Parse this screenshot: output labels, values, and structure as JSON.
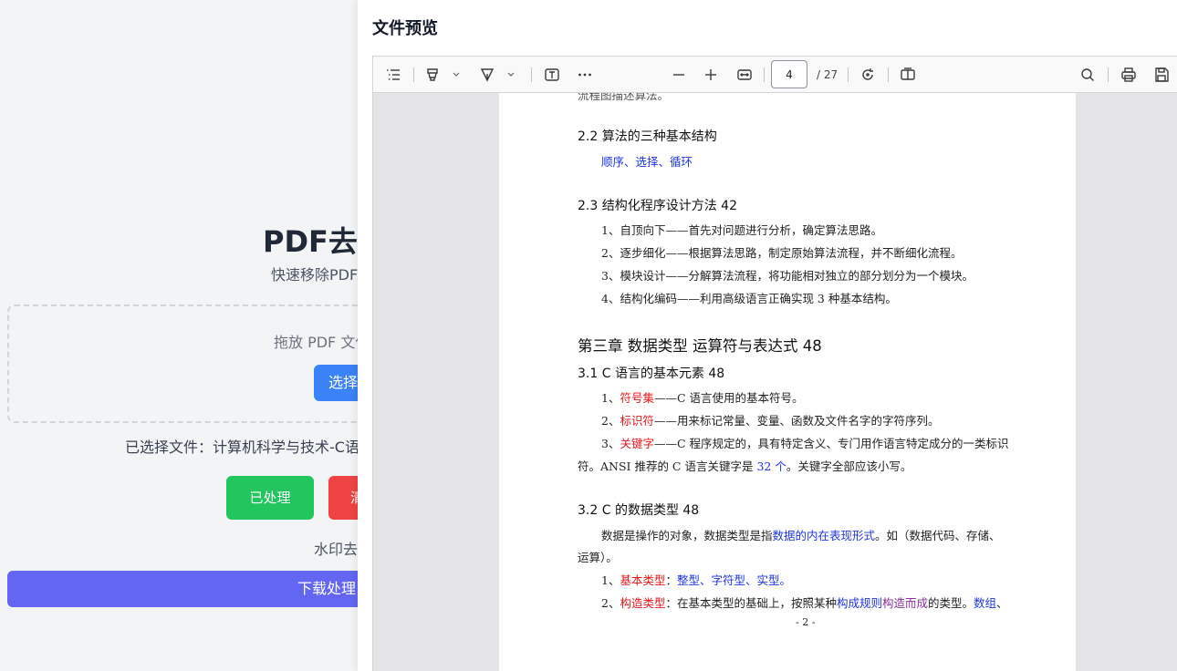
{
  "app": {
    "title": "PDF去水",
    "subtitle": "快速移除PDF",
    "drop_text": "拖放 PDF 文件",
    "choose_button": "选择",
    "selected_file": "已选择文件：计算机科学与技术-C语",
    "processed_button": "已处理",
    "clear_button": "清",
    "watermark_status": "水印去",
    "download_button": "下载处理"
  },
  "modal": {
    "title": "文件预览"
  },
  "toolbar": {
    "icons": {
      "sidebar": "sidebar-toggle-icon",
      "highlight": "highlight-pen-icon",
      "ink": "ink-pen-icon",
      "text": "text-box-icon",
      "more": "more-icon",
      "zoom_out": "zoom-out-icon",
      "zoom_in": "zoom-in-icon",
      "fit": "fit-page-icon",
      "rotate": "rotate-icon",
      "two_page": "two-page-icon",
      "search": "search-icon",
      "print": "print-icon",
      "save": "save-icon"
    },
    "page_number": "4",
    "page_total": "/ 27"
  },
  "pdf": {
    "top_clip": "流程图描述算法。",
    "s22_title": "2.2  算法的三种基本结构",
    "s22_body": "顺序、选择、循环",
    "s23_title": "2.3  结构化程序设计方法 42",
    "s23_items": [
      "1、自顶向下——首先对问题进行分析，确定算法思路。",
      "2、逐步细化——根据算法思路，制定原始算法流程，并不断细化流程。",
      "3、模块设计——分解算法流程，将功能相对独立的部分划分为一个模块。",
      "4、结构化编码——利用高级语言正确实现 3 种基本结构。"
    ],
    "ch3_title": "第三章  数据类型  运算符与表达式 48",
    "s31_title": "3.1 C 语言的基本元素 48",
    "s31": {
      "i1_num": "1、",
      "i1_key": "符号集",
      "i1_rest": "——C 语言使用的基本符号。",
      "i2_num": "2、",
      "i2_key": "标识符",
      "i2_rest": "——用来标记常量、变量、函数及文件名字的字符序列。",
      "i3_num": "3、",
      "i3_key": "关键字",
      "i3_rest": "——C 程序规定的，具有特定含义、专门用作语言特定成分的一类标识",
      "i3_cont_a": "符。ANSI 推荐的 C 语言关键字是 ",
      "i3_cont_b": "32 个",
      "i3_cont_c": "。关键字全部应该小写。"
    },
    "s32_title": "3.2 C 的数据类型 48",
    "s32": {
      "p_a": "数据是操作的对象，数据类型是指",
      "p_b": "数据的内在表现形式",
      "p_c": "。如（数据代码、存储、",
      "p_cont": "运算）。",
      "i1_num": "1、",
      "i1_key": "基本类型",
      "i1_colon": "：",
      "i1_val": "整型、字符型、实型。",
      "i2_num": "2、",
      "i2_key": "构造类型",
      "i2_a": "：在基本类型的基础上，按照某种",
      "i2_b": "构成规则",
      "i2_c": "构造而成",
      "i2_d": "的类型。",
      "i2_e": "数组",
      "i2_f": "、"
    },
    "page_footer": "- 2 -"
  },
  "colors": {
    "keyword_red": "#e3181a",
    "keyword_blue": "#1c35e0",
    "keyword_purple": "#8b2fa3",
    "processed_green": "#22c55e",
    "clear_red": "#ef4444",
    "choose_blue": "#3b82f6",
    "download_indigo": "#6366f1"
  }
}
